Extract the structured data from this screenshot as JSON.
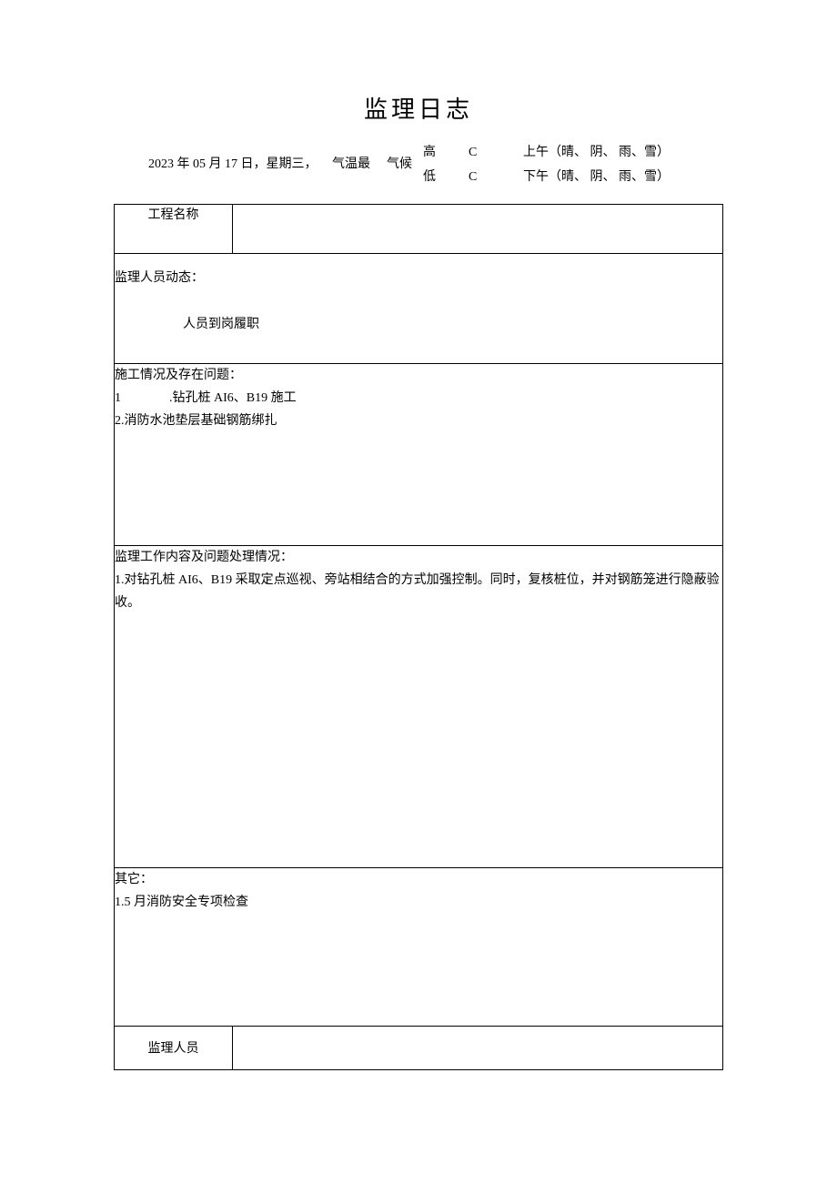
{
  "title": "监理日志",
  "header": {
    "date": "2023 年 05 月 17 日，星期三，",
    "temp_label": "气温最",
    "high_label": "高",
    "low_label": "低",
    "unit_high": "C",
    "unit_low": "C",
    "climate_label": "气候",
    "am_weather": "上午（晴、 阴、 雨、雪）",
    "pm_weather": "下午（晴、 阴、 雨、雪）"
  },
  "rows": {
    "project_label": "工程名称",
    "project_value": "",
    "personnel_title": "监理人员动态：",
    "personnel_content": "人员到岗履职",
    "construction_title": "施工情况及存在问题：",
    "construction_line1_num": "1",
    "construction_line1_text": ".钻孔桩 AI6、B19 施工",
    "construction_line2": "2.消防水池垫层基础钢筋绑扎",
    "supervision_title": "监理工作内容及问题处理情况：",
    "supervision_line1": "1.对钻孔桩 AI6、B19 采取定点巡视、旁站相结合的方式加强控制。同时，复核桩位，并对钢筋笼进行隐蔽验收。",
    "other_title": "其它：",
    "other_line1": "1.5 月消防安全专项检查",
    "sign_label": "监理人员",
    "sign_value": ""
  }
}
